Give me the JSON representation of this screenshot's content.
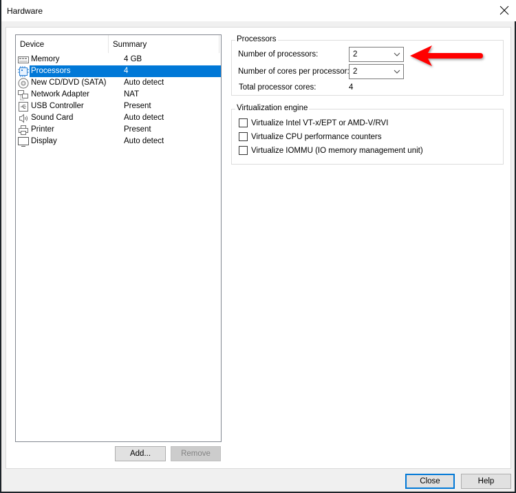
{
  "window": {
    "title": "Hardware",
    "close_icon": "close-x-icon"
  },
  "device_list": {
    "columns": [
      "Device",
      "Summary"
    ],
    "items": [
      {
        "name": "Memory",
        "summary": "4 GB",
        "icon": "memory-icon",
        "selected": false
      },
      {
        "name": "Processors",
        "summary": "4",
        "icon": "processor-icon",
        "selected": true
      },
      {
        "name": "New CD/DVD (SATA)",
        "summary": "Auto detect",
        "icon": "cd-dvd-icon",
        "selected": false
      },
      {
        "name": "Network Adapter",
        "summary": "NAT",
        "icon": "network-icon",
        "selected": false
      },
      {
        "name": "USB Controller",
        "summary": "Present",
        "icon": "usb-icon",
        "selected": false
      },
      {
        "name": "Sound Card",
        "summary": "Auto detect",
        "icon": "speaker-icon",
        "selected": false
      },
      {
        "name": "Printer",
        "summary": "Present",
        "icon": "printer-icon",
        "selected": false
      },
      {
        "name": "Display",
        "summary": "Auto detect",
        "icon": "monitor-icon",
        "selected": false
      }
    ],
    "add_label": "Add...",
    "remove_label": "Remove"
  },
  "processors_group": {
    "title": "Processors",
    "num_processors_label": "Number of processors:",
    "num_processors_value": "2",
    "cores_per_processor_label": "Number of cores per processor:",
    "cores_per_processor_value": "2",
    "total_cores_label": "Total processor cores:",
    "total_cores_value": "4"
  },
  "virtualization_group": {
    "title": "Virtualization engine",
    "options": [
      {
        "label": "Virtualize Intel VT-x/EPT or AMD-V/RVI",
        "checked": false
      },
      {
        "label": "Virtualize CPU performance counters",
        "checked": false
      },
      {
        "label": "Virtualize IOMMU (IO memory management unit)",
        "checked": false
      }
    ]
  },
  "footer": {
    "close_label": "Close",
    "help_label": "Help"
  },
  "annotation": {
    "arrow_color": "#ff0000",
    "points_to": "number-of-processors-combo"
  },
  "colors": {
    "selection": "#0078d7",
    "default_button_border": "#0078d7"
  }
}
